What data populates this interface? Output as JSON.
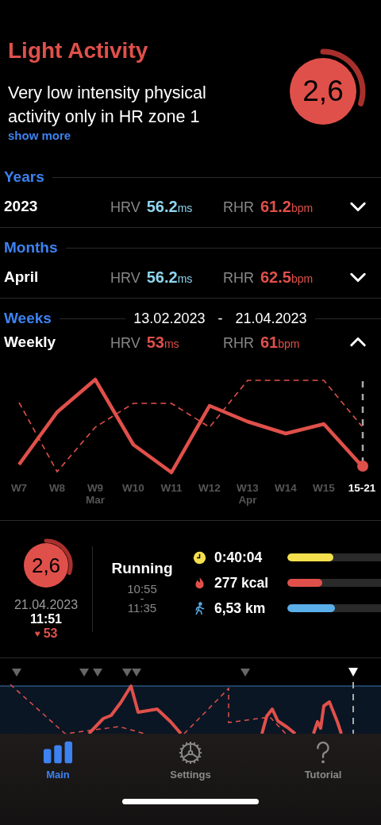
{
  "header": {
    "title": "Light Activity",
    "description": "Very low intensity physical activity only in HR zone 1",
    "link": "show more",
    "score": {
      "value": "2,6"
    }
  },
  "sections": [
    {
      "heading": "Years",
      "label": "2023",
      "hrv": {
        "label": "HRV",
        "value": "56.2",
        "unit": "ms",
        "color": "#8fd6f0"
      },
      "rhr": {
        "label": "RHR",
        "value": "61.2",
        "unit": "bpm",
        "color": "#e0504a"
      },
      "expanded": false
    },
    {
      "heading": "Months",
      "label": "April",
      "hrv": {
        "label": "HRV",
        "value": "56.2",
        "unit": "ms",
        "color": "#8fd6f0"
      },
      "rhr": {
        "label": "RHR",
        "value": "62.5",
        "unit": "bpm",
        "color": "#e0504a"
      },
      "expanded": false
    },
    {
      "heading": "Weeks",
      "range_start": "13.02.2023",
      "range_separator": "-",
      "range_end": "21.04.2023",
      "label": "Weekly",
      "hrv": {
        "label": "HRV",
        "value": "53",
        "unit": "ms",
        "color": "#e0504a"
      },
      "rhr": {
        "label": "RHR",
        "value": "61",
        "unit": "bpm",
        "color": "#e0504a"
      },
      "expanded": true
    }
  ],
  "week_chart": {
    "labels": [
      {
        "text": "W7",
        "selected": false
      },
      {
        "text": "W8",
        "selected": false
      },
      {
        "text": "W9",
        "sub": "Mar",
        "selected": false
      },
      {
        "text": "W10",
        "selected": false
      },
      {
        "text": "W11",
        "selected": false
      },
      {
        "text": "W12",
        "selected": false
      },
      {
        "text": "W13",
        "sub": "Apr",
        "selected": false
      },
      {
        "text": "W14",
        "selected": false
      },
      {
        "text": "W15",
        "selected": false
      },
      {
        "text": "15-21",
        "selected": true
      }
    ]
  },
  "activity": {
    "score": {
      "value": "2,6"
    },
    "date": "21.04.2023",
    "time": "11:51",
    "heart_icon": "♥",
    "heart_rate": "53",
    "name": "Running",
    "start": "10:55",
    "separator": "-",
    "end": "11:35",
    "metrics": [
      {
        "kind": "duration",
        "value": "0:40:04",
        "level": 0.49,
        "color": "#f4e04d"
      },
      {
        "kind": "calories",
        "value": "277 kcal",
        "level": 0.37,
        "color": "#e0504a"
      },
      {
        "kind": "distance",
        "value": "6,53 km",
        "level": 0.51,
        "color": "#5aaeea"
      }
    ]
  },
  "tab_bar": [
    {
      "kind": "main",
      "label": "Main",
      "selected": true
    },
    {
      "kind": "settings",
      "label": "Settings",
      "selected": false
    },
    {
      "kind": "tutorial",
      "label": "Tutorial",
      "selected": false
    }
  ]
}
